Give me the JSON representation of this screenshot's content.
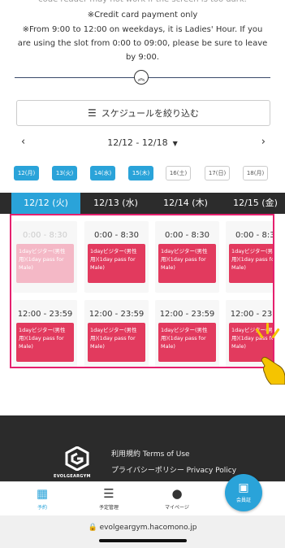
{
  "notice": {
    "clipped_line": "code reader may not work if the screen is too dark.",
    "line1": "※Credit card payment only",
    "line2": "※From 9:00 to 12:00 on weekdays, it is Ladies' Hour. If you are using the slot from 0:00 to 09:00, please be sure to leave by 9:00."
  },
  "filter": {
    "label": "スケジュールを絞り込む",
    "icon": "filter-lines-icon"
  },
  "week_nav": {
    "prev": "‹",
    "range": "12/12 - 12/18",
    "next": "›"
  },
  "day_chips": [
    {
      "label": "12(月)",
      "selected": true
    },
    {
      "label": "13(火)",
      "selected": true
    },
    {
      "label": "14(水)",
      "selected": true
    },
    {
      "label": "15(木)",
      "selected": true
    },
    {
      "label": "16(土)",
      "selected": false
    },
    {
      "label": "17(日)",
      "selected": false
    },
    {
      "label": "18(月)",
      "selected": false
    }
  ],
  "date_tabs": [
    "12/12 (火)",
    "12/13 (水)",
    "12/14 (木)",
    "12/15 (金)"
  ],
  "slots": {
    "morning_time": "0:00 - 8:30",
    "evening_time": "12:00 - 23:59",
    "card_text": "1dayビジター(男性用)(1day pass for Male)"
  },
  "footer": {
    "logo_text": "EVOLGEARGYM",
    "terms": "利用規約 Terms of Use",
    "privacy": "プライバシーポリシー Privacy Policy"
  },
  "bottom_nav": {
    "reserve": "予約",
    "schedule": "予定管理",
    "mypage": "マイページ",
    "member": "会員証"
  },
  "url": "evolgeargym.hacomono.jp",
  "colors": {
    "accent": "#2aa3d9",
    "slot_card": "#e23a5e",
    "highlight_border": "#e5206e"
  }
}
